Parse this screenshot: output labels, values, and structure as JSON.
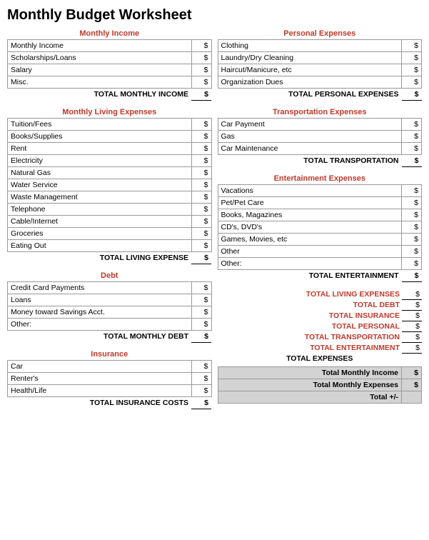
{
  "title": "Monthly Budget Worksheet",
  "left": {
    "monthly_income": {
      "section_title": "Monthly Income",
      "rows": [
        {
          "label": "Monthly Income"
        },
        {
          "label": "Scholarships/Loans"
        },
        {
          "label": "Salary"
        },
        {
          "label": "Misc."
        }
      ],
      "total_label": "TOTAL MONTHLY INCOME",
      "dollar": "$"
    },
    "living_expenses": {
      "section_title": "Monthly Living Expenses",
      "rows": [
        {
          "label": "Tuition/Fees"
        },
        {
          "label": "Books/Supplies"
        },
        {
          "label": "Rent"
        },
        {
          "label": "Electricity"
        },
        {
          "label": "Natural Gas"
        },
        {
          "label": "Water Service"
        },
        {
          "label": "Waste Management"
        },
        {
          "label": "Telephone"
        },
        {
          "label": "Cable/Internet"
        },
        {
          "label": "Groceries"
        },
        {
          "label": "Eating Out"
        }
      ],
      "total_label": "TOTAL LIVING EXPENSE",
      "dollar": "$"
    },
    "debt": {
      "section_title": "Debt",
      "rows": [
        {
          "label": "Credit Card Payments"
        },
        {
          "label": "Loans"
        },
        {
          "label": "Money toward Savings Acct."
        },
        {
          "label": "Other:"
        }
      ],
      "total_label": "TOTAL MONTHLY DEBT",
      "dollar": "$"
    },
    "insurance": {
      "section_title": "Insurance",
      "rows": [
        {
          "label": "Car"
        },
        {
          "label": "Renter's"
        },
        {
          "label": "Health/Life"
        }
      ],
      "total_label": "TOTAL INSURANCE COSTS",
      "dollar": "$"
    }
  },
  "right": {
    "personal_expenses": {
      "section_title": "Personal Expenses",
      "rows": [
        {
          "label": "Clothing"
        },
        {
          "label": "Laundry/Dry Cleaning"
        },
        {
          "label": "Haircut/Manicure, etc"
        },
        {
          "label": "Organization Dues"
        }
      ],
      "total_label": "TOTAL PERSONAL EXPENSES",
      "dollar": "$"
    },
    "transportation": {
      "section_title": "Transportation Expenses",
      "rows": [
        {
          "label": "Car Payment"
        },
        {
          "label": "Gas"
        },
        {
          "label": "Car Maintenance"
        }
      ],
      "total_label": "TOTAL TRANSPORTATION",
      "dollar": "$"
    },
    "entertainment": {
      "section_title": "Entertainment Expenses",
      "rows": [
        {
          "label": "Vacations"
        },
        {
          "label": "Pet/Pet Care"
        },
        {
          "label": "Books, Magazines"
        },
        {
          "label": "CD's, DVD's"
        },
        {
          "label": "Games, Movies, etc"
        },
        {
          "label": "Other"
        },
        {
          "label": "Other:"
        }
      ],
      "total_label": "TOTAL ENTERTAINMENT",
      "dollar": "$"
    },
    "summary": {
      "items": [
        {
          "label": "TOTAL LIVING EXPENSES",
          "dollar": "$"
        },
        {
          "label": "TOTAL DEBT",
          "dollar": "$"
        },
        {
          "label": "TOTAL INSURANCE",
          "dollar": "$"
        },
        {
          "label": "TOTAL PERSONAL",
          "dollar": "$"
        },
        {
          "label": "TOTAL TRANSPORTATION",
          "dollar": "$"
        },
        {
          "label": "TOTAL ENTERTAINMENT",
          "dollar": "$"
        }
      ],
      "total_expenses_label": "TOTAL EXPENSES",
      "grand": [
        {
          "label": "Total Monthly Income",
          "dollar": "$"
        },
        {
          "label": "Total Monthly Expenses",
          "dollar": "$"
        },
        {
          "label": "Total +/-",
          "dollar": ""
        }
      ]
    }
  }
}
